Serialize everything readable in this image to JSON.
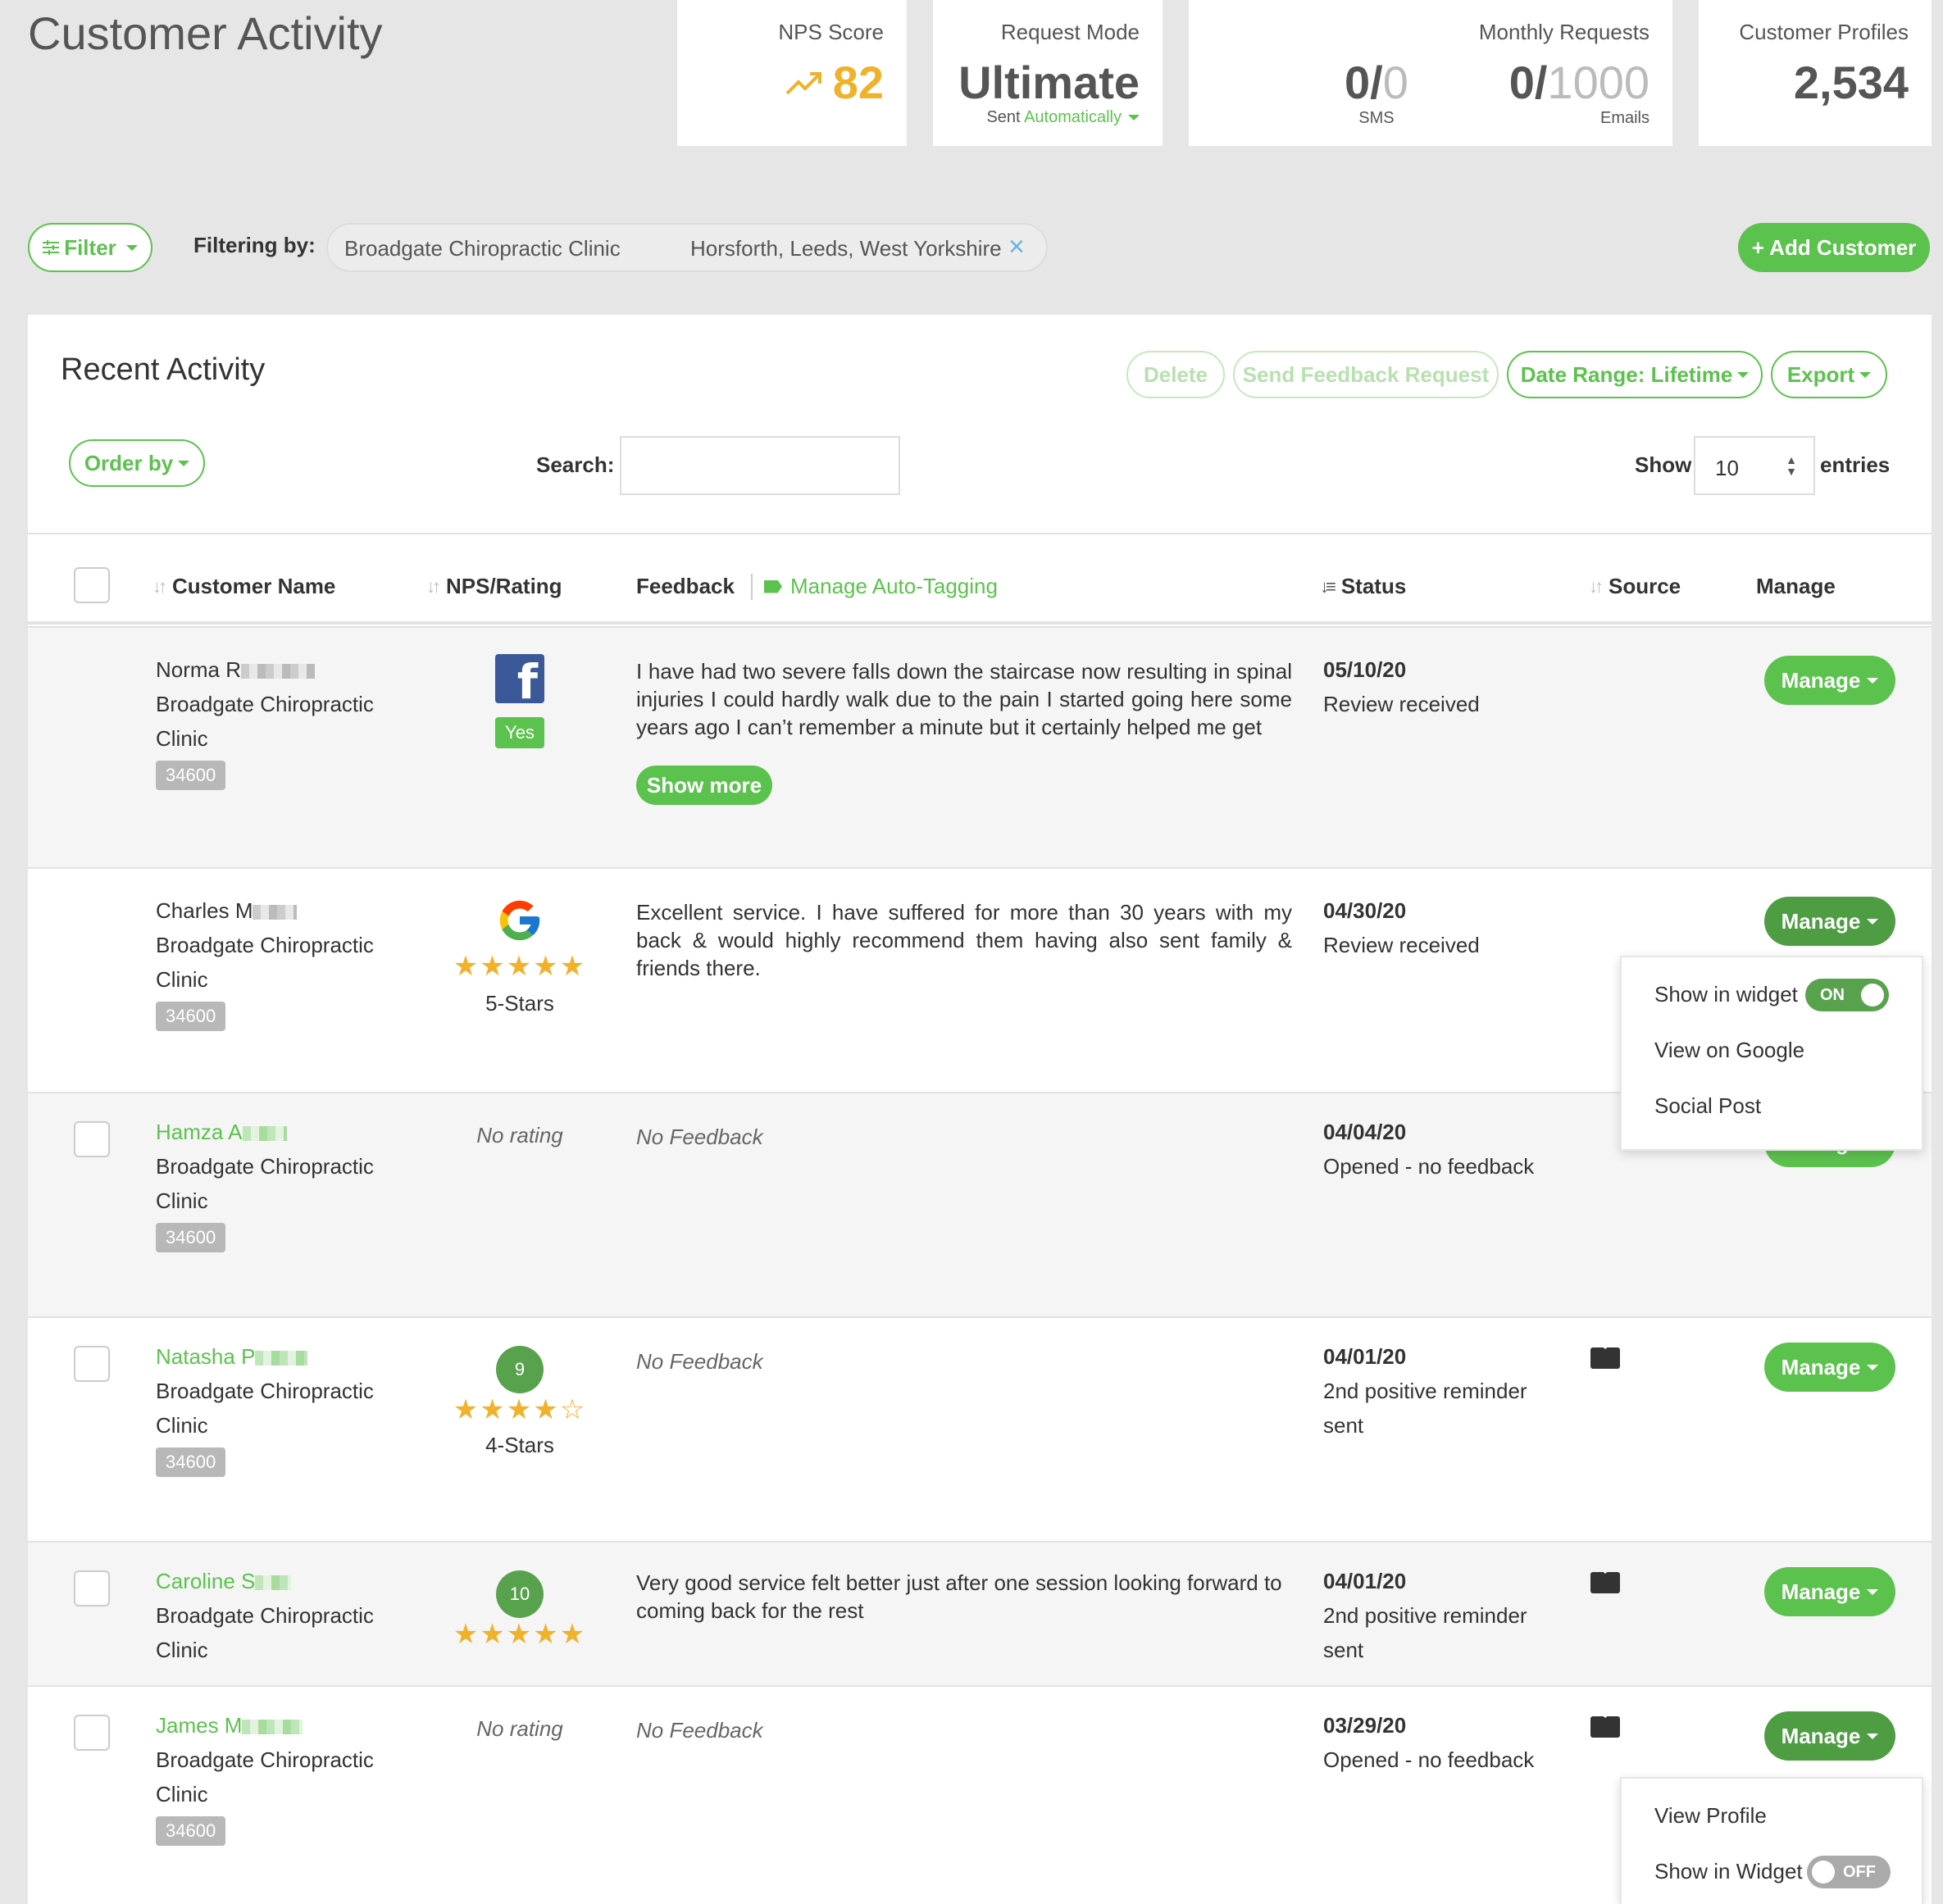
{
  "page": {
    "title": "Customer Activity"
  },
  "stats": {
    "nps": {
      "label": "NPS Score",
      "value": "82"
    },
    "mode": {
      "label": "Request Mode",
      "value": "Ultimate",
      "sub_prefix": "Sent",
      "sub_link": "Automatically"
    },
    "monthly": {
      "label": "Monthly Requests",
      "sms": {
        "used": "0/",
        "limit": "0",
        "unit": "SMS"
      },
      "emails": {
        "used": "0/",
        "limit": "1000",
        "unit": "Emails"
      }
    },
    "profiles": {
      "label": "Customer Profiles",
      "value": "2,534"
    }
  },
  "filterbar": {
    "filter_label": "Filter",
    "filtering_by": "Filtering by:",
    "chip_name": "Broadgate Chiropractic Clinic",
    "chip_location": "Horsforth, Leeds, West Yorkshire",
    "add_customer": "+ Add Customer"
  },
  "panel": {
    "title": "Recent Activity",
    "delete": "Delete",
    "send_feedback": "Send Feedback Request",
    "date_range": "Date Range: Lifetime",
    "export": "Export",
    "order_by": "Order by",
    "search_label": "Search:",
    "search_value": "",
    "show_label": "Show",
    "show_value": "10",
    "entries_label": "entries"
  },
  "columns": {
    "customer_name": "Customer Name",
    "nps_rating": "NPS/Rating",
    "feedback": "Feedback",
    "manage_tagging": "Manage Auto-Tagging",
    "status": "Status",
    "source": "Source",
    "manage": "Manage"
  },
  "rows": [
    {
      "name": "Norma R",
      "clinic_line1": "Broadgate Chiropractic",
      "clinic_line2": "Clinic",
      "id": "34600",
      "source_icon": "facebook-icon",
      "rating_badge": "Yes",
      "feedback": "I have had two severe falls down the staircase now resulting in spinal injuries I could hardly walk due to the pain I started going here some years ago I can’t remember a minute but it certainly helped me get",
      "show_more": "Show more",
      "date": "05/10/20",
      "status": "Review received",
      "manage": "Manage"
    },
    {
      "name": "Charles M",
      "clinic_line1": "Broadgate Chiropractic",
      "clinic_line2": "Clinic",
      "id": "34600",
      "source_icon": "google-icon",
      "stars": 5,
      "rating_label": "5-Stars",
      "feedback": "Excellent service. I have suffered for more than 30 years with my back & would highly recommend them having also sent family & friends there.",
      "date": "04/30/20",
      "status": "Review received",
      "manage": "Manage"
    },
    {
      "name": "Hamza A",
      "clinic_line1": "Broadgate Chiropractic",
      "clinic_line2": "Clinic",
      "id": "34600",
      "rating_text": "No rating",
      "feedback": "No Feedback",
      "date": "04/04/20",
      "status": "Opened - no feedback",
      "manage": "Manage"
    },
    {
      "name": "Natasha P",
      "clinic_line1": "Broadgate Chiropractic",
      "clinic_line2": "Clinic",
      "id": "34600",
      "nps": "9",
      "stars": 4,
      "rating_label": "4-Stars",
      "feedback": "No Feedback",
      "date": "04/01/20",
      "status_line1": "2nd positive reminder",
      "status_line2": "sent",
      "source_icon": "mail-icon",
      "manage": "Manage"
    },
    {
      "name": "Caroline S",
      "clinic_line1": "Broadgate Chiropractic",
      "clinic_line2": "Clinic",
      "nps": "10",
      "stars": 5,
      "feedback": "Very good service felt better just after one session looking forward to coming back for the rest",
      "date": "04/01/20",
      "status_line1": "2nd positive reminder",
      "status_line2": "sent",
      "source_icon": "mail-icon",
      "manage": "Manage"
    },
    {
      "name": "James M",
      "clinic_line1": "Broadgate Chiropractic",
      "clinic_line2": "Clinic",
      "id": "34600",
      "rating_text": "No rating",
      "feedback": "No Feedback",
      "date": "03/29/20",
      "status": "Opened - no feedback",
      "source_icon": "mail-icon",
      "manage": "Manage"
    }
  ],
  "menu_row2": {
    "show_in_widget": "Show in widget",
    "toggle": "ON",
    "view_google": "View on Google",
    "social_post": "Social Post"
  },
  "menu_row6": {
    "view_profile": "View Profile",
    "show_in_widget": "Show in Widget",
    "toggle": "OFF"
  },
  "colors": {
    "accent": "#5cc24e",
    "nps": "#f0b22c",
    "star": "#f0b22c"
  }
}
